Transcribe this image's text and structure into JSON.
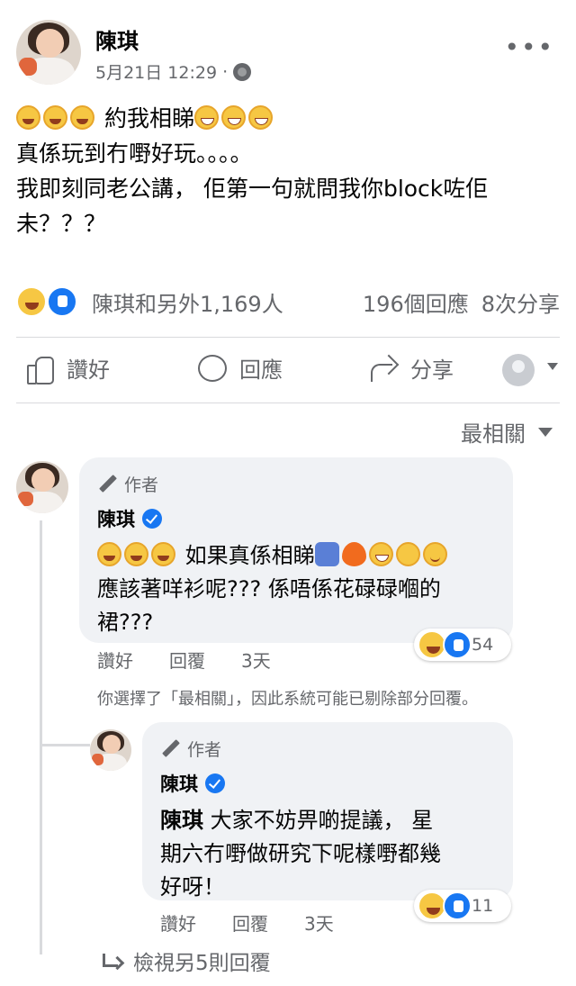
{
  "post": {
    "author": "陳琪",
    "timestamp": "5月21日 12:29",
    "separator": "·",
    "more_label": "•••",
    "body_line1_text": "約我相睇",
    "body_line2": "真係玩到冇嘢好玩。。。。",
    "body_line3": "我即刻同老公講， 佢第一句就問我你block咗佢",
    "body_line4": "未？？？"
  },
  "reactions": {
    "summary": "陳琪和另外1,169人",
    "comments_count": "196個回應",
    "shares_count": "8次分享"
  },
  "actions": {
    "like": "讚好",
    "comment": "回應",
    "share": "分享"
  },
  "sort": {
    "label": "最相關"
  },
  "comment1": {
    "badge": "作者",
    "author": "陳琪",
    "line1_text": "如果真係相睇",
    "line2": "應該著咩衫呢??? 係唔係花碌碌嗰的",
    "line3": "裙???",
    "reaction_count": "54",
    "like": "讚好",
    "reply": "回覆",
    "time": "3天"
  },
  "filter_note": "你選擇了「最相關」，因此系統可能已剔除部分回覆。",
  "reply1": {
    "badge": "作者",
    "author": "陳琪",
    "mention": "陳琪",
    "line1_text": " 大家不妨畀啲提議， 星",
    "line2": "期六冇嘢做研究下呢樣嘢都幾",
    "line3": "好呀！",
    "reaction_count": "11",
    "like": "讚好",
    "reply": "回覆",
    "time": "3天"
  },
  "view_more": "檢視另5則回覆",
  "colors": {
    "accent": "#1877f2",
    "secondary_text": "#65676b",
    "bubble": "#f0f2f5",
    "haha": "#f6c743"
  }
}
